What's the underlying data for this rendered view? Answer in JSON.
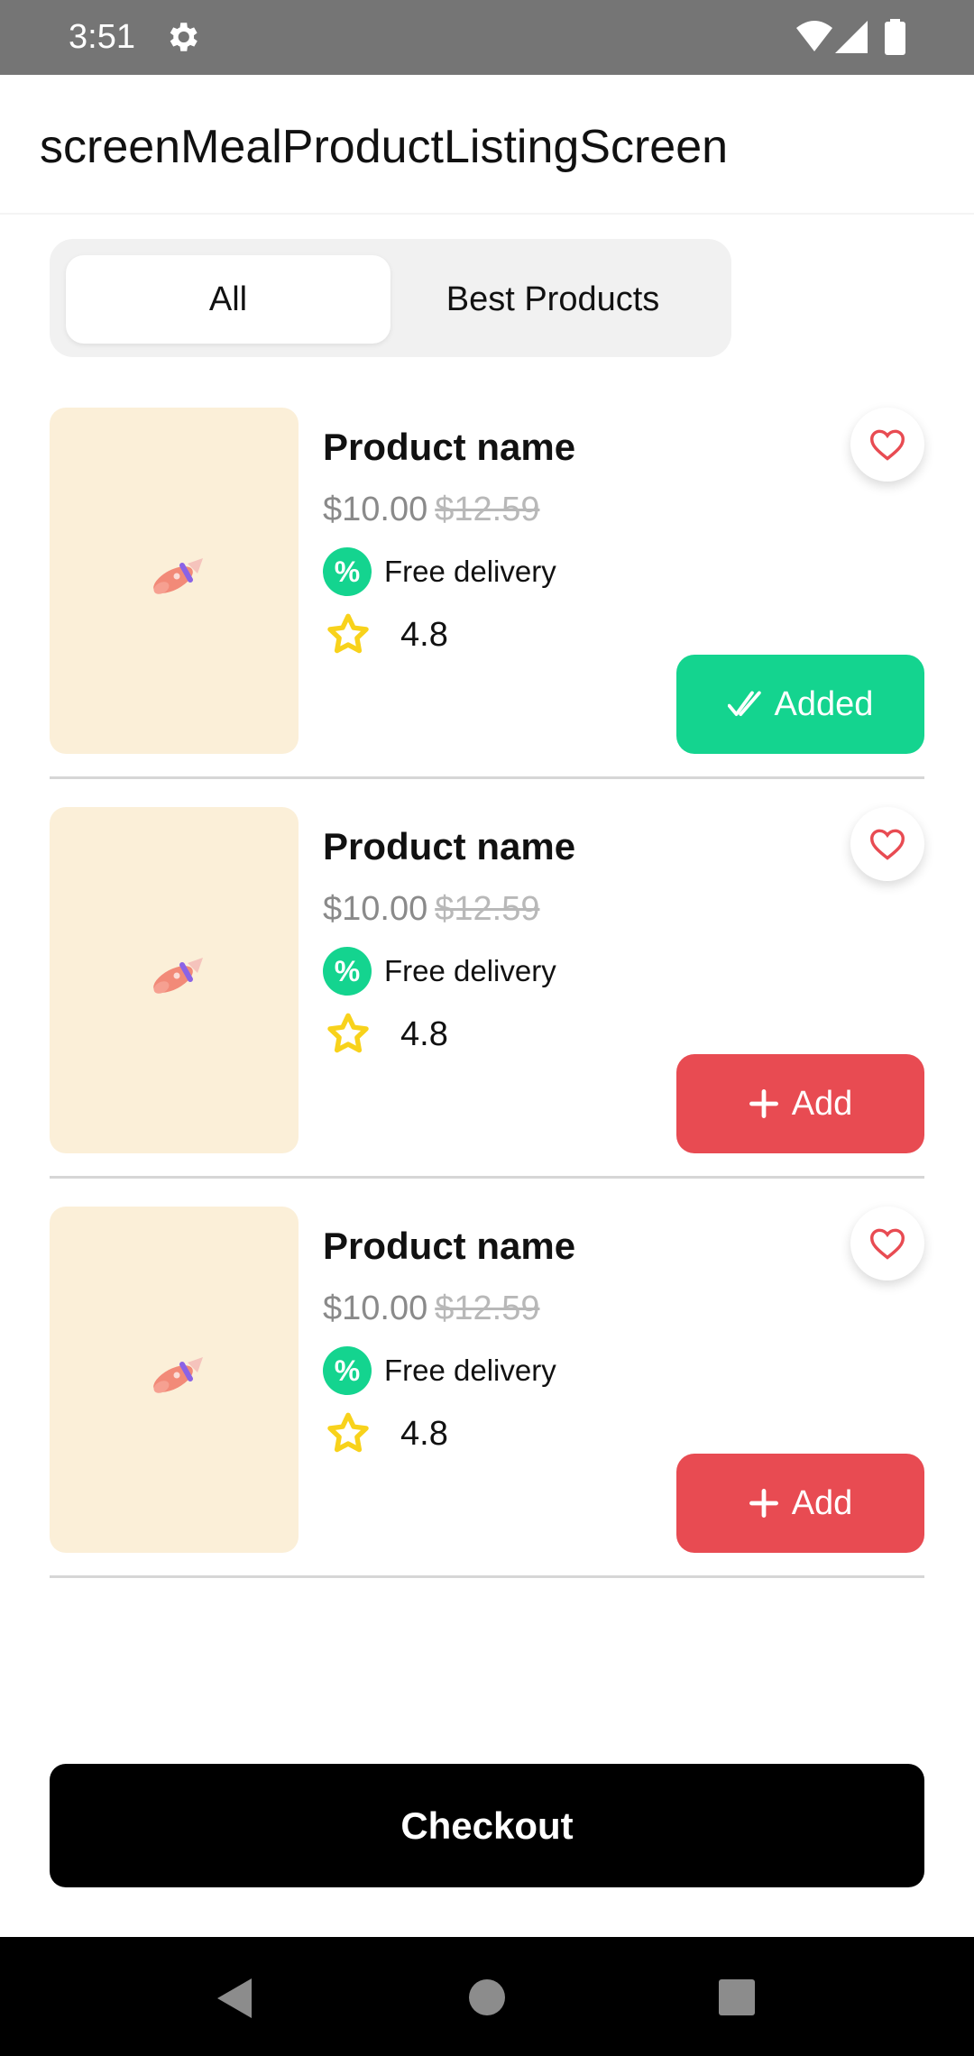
{
  "status_bar": {
    "time": "3:51",
    "icons": [
      "gear-icon",
      "wifi-icon",
      "signal-icon",
      "battery-icon"
    ]
  },
  "app_bar": {
    "title": "screenMealProductListingScreen"
  },
  "tabs": [
    {
      "label": "All",
      "selected": true
    },
    {
      "label": "Best Products",
      "selected": false
    }
  ],
  "products": [
    {
      "name": "Product name",
      "price": "$10.00",
      "old_price": "$12.59",
      "discount_symbol": "%",
      "delivery": "Free delivery",
      "rating": "4.8",
      "action_label": "Added",
      "action_state": "added"
    },
    {
      "name": "Product name",
      "price": "$10.00",
      "old_price": "$12.59",
      "discount_symbol": "%",
      "delivery": "Free delivery",
      "rating": "4.8",
      "action_label": "Add",
      "action_state": "add"
    },
    {
      "name": "Product name",
      "price": "$10.00",
      "old_price": "$12.59",
      "discount_symbol": "%",
      "delivery": "Free delivery",
      "rating": "4.8",
      "action_label": "Add",
      "action_state": "add"
    }
  ],
  "checkout": {
    "label": "Checkout"
  },
  "colors": {
    "status_bar": "#757575",
    "image_bg": "#fbefd8",
    "accent_green": "#14d48f",
    "accent_red": "#e84b52",
    "star_yellow": "#f8d21b",
    "checkout_bg": "#000000"
  }
}
